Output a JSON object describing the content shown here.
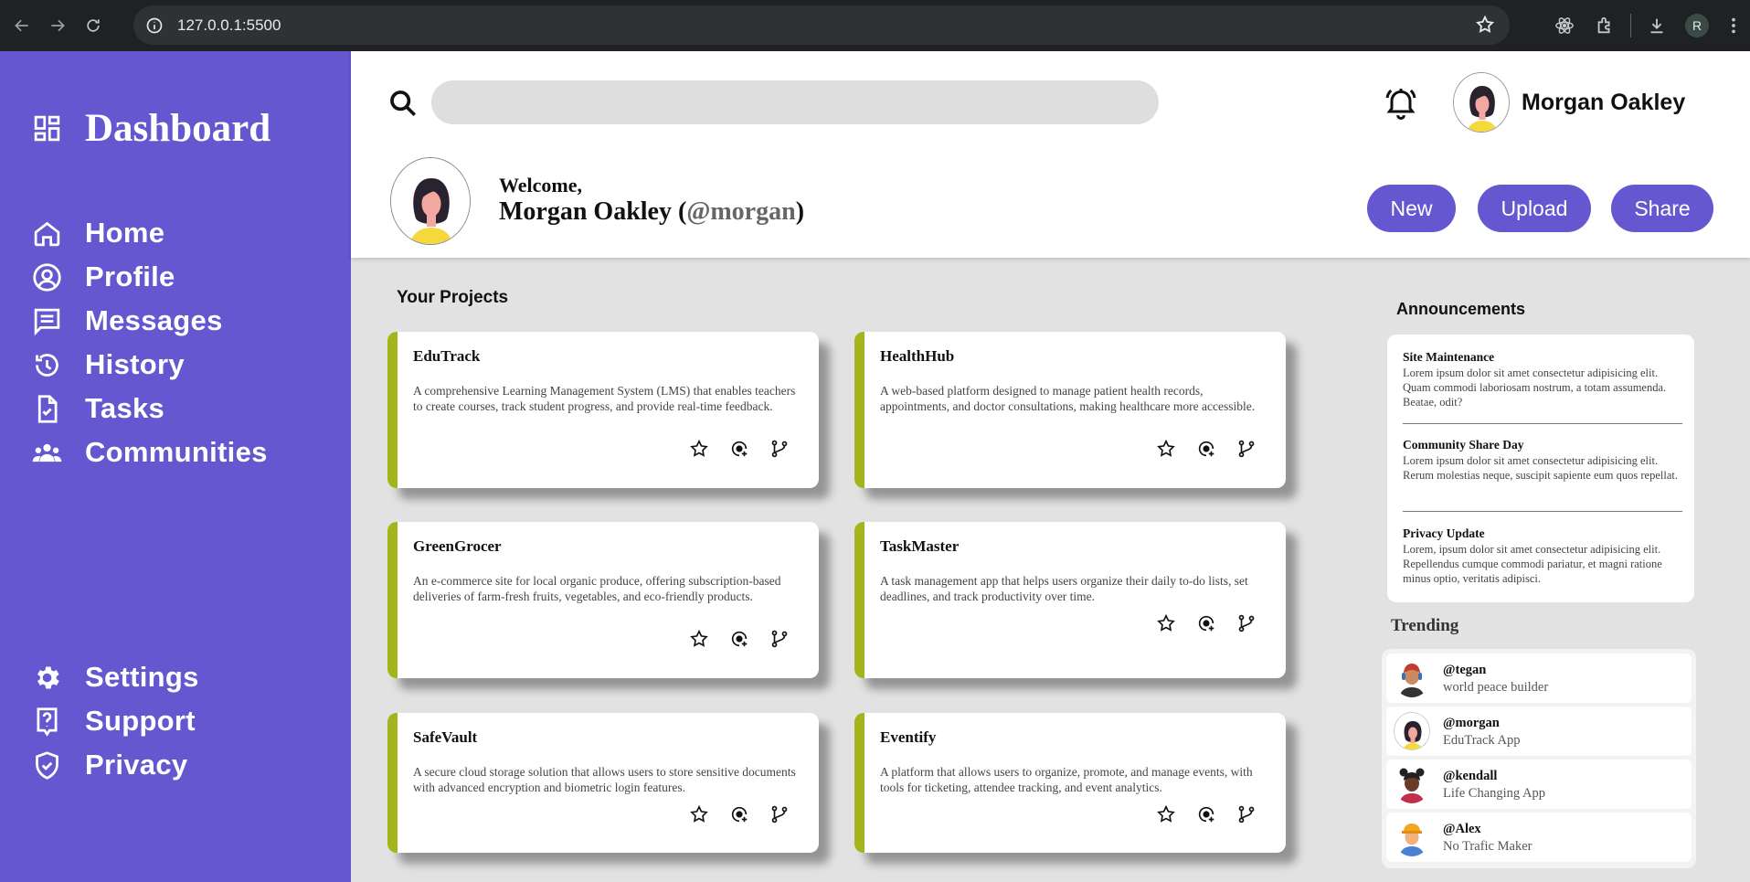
{
  "browser": {
    "url": "127.0.0.1:5500",
    "profile_initial": "R"
  },
  "sidebar": {
    "title": "Dashboard",
    "items": [
      {
        "label": "Home",
        "icon": "home-icon"
      },
      {
        "label": "Profile",
        "icon": "profile-icon"
      },
      {
        "label": "Messages",
        "icon": "messages-icon"
      },
      {
        "label": "History",
        "icon": "history-icon"
      },
      {
        "label": "Tasks",
        "icon": "tasks-icon"
      },
      {
        "label": "Communities",
        "icon": "communities-icon"
      }
    ],
    "bottom_items": [
      {
        "label": "Settings",
        "icon": "gear-icon"
      },
      {
        "label": "Support",
        "icon": "support-icon"
      },
      {
        "label": "Privacy",
        "icon": "shield-icon"
      }
    ]
  },
  "header": {
    "search_placeholder": "",
    "user_name": "Morgan Oakley",
    "welcome_label": "Welcome,",
    "welcome_name": "Morgan Oakley (",
    "welcome_handle": "@morgan",
    "welcome_close": ")",
    "buttons": {
      "new": "New",
      "upload": "Upload",
      "share": "Share"
    }
  },
  "projects": {
    "title": "Your Projects",
    "cards": [
      {
        "title": "EduTrack",
        "description": "A comprehensive Learning Management System (LMS) that enables teachers to create courses, track student progress, and provide real-time feedback."
      },
      {
        "title": "HealthHub",
        "description": "A web-based platform designed to manage patient health records, appointments, and doctor consultations, making healthcare more accessible."
      },
      {
        "title": "GreenGrocer",
        "description": "An e-commerce site for local organic produce, offering subscription-based deliveries of farm-fresh fruits, vegetables, and eco-friendly products."
      },
      {
        "title": "TaskMaster",
        "description": "A task management app that helps users organize their daily to-do lists, set deadlines, and track productivity over time."
      },
      {
        "title": "SafeVault",
        "description": "A secure cloud storage solution that allows users to store sensitive documents with advanced encryption and biometric login features."
      },
      {
        "title": "Eventify",
        "description": "A platform that allows users to organize, promote, and manage events, with tools for ticketing, attendee tracking, and event analytics."
      }
    ]
  },
  "announcements": {
    "title": "Announcements",
    "items": [
      {
        "title": "Site Maintenance",
        "body": "Lorem ipsum dolor sit amet consectetur adipisicing elit. Quam commodi laboriosam nostrum, a totam assumenda. Beatae, odit?"
      },
      {
        "title": "Community Share Day",
        "body": "Lorem ipsum dolor sit amet consectetur adipisicing elit. Rerum molestias neque, suscipit sapiente eum quos repellat."
      },
      {
        "title": "Privacy Update",
        "body": "Lorem, ipsum dolor sit amet consectetur adipisicing elit. Repellendus cumque commodi pariatur, et magni ratione minus optio, veritatis adipisci."
      }
    ]
  },
  "trending": {
    "title": "Trending",
    "items": [
      {
        "handle": "@tegan",
        "subtitle": "world peace builder"
      },
      {
        "handle": "@morgan",
        "subtitle": "EduTrack App"
      },
      {
        "handle": "@kendall",
        "subtitle": "Life Changing App"
      },
      {
        "handle": "@Alex",
        "subtitle": "No Trafic Maker"
      }
    ]
  },
  "colors": {
    "accent": "#6457cf",
    "card_border": "#a5b41d",
    "background": "#e2e2e2"
  }
}
